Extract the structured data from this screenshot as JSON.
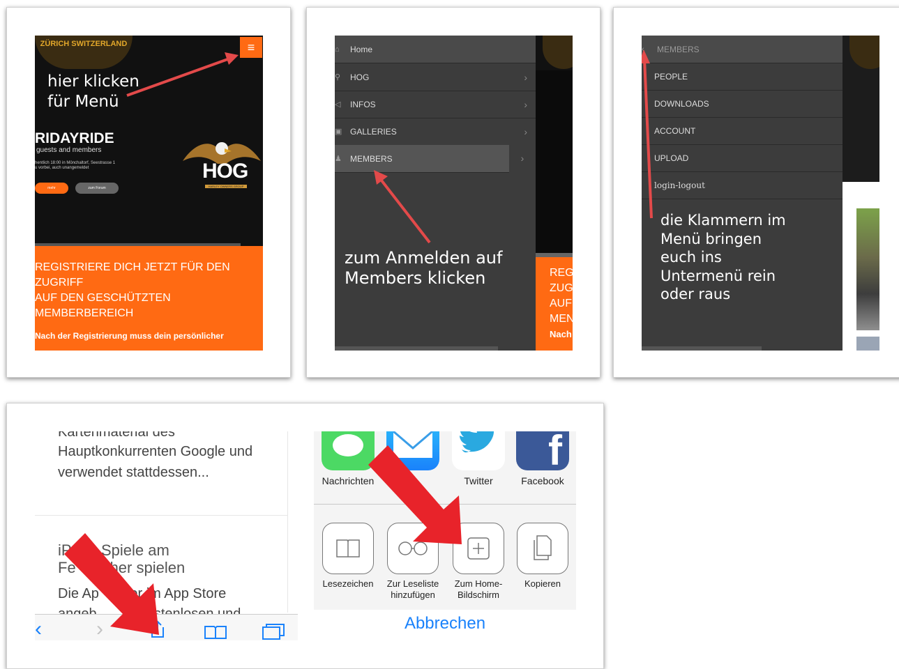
{
  "panel1": {
    "logo_text": "ZÜRICH SWITZERLAND",
    "annotation_line1": "hier klicken",
    "annotation_line2": "für Menü",
    "hero_title": "RIDAYRIDE",
    "hero_sub": "guests and members",
    "hero_detail1": "hentlich 18:00 in Mönchaltorf, Seestrasse 1",
    "hero_detail2": "u vorbei, auch unangemeldet",
    "btn_orange": "mehr",
    "btn_grey": "zum Forum",
    "hog_logo": "HOG",
    "hog_sub": "HARLEY OWNERS GROUP",
    "register_line1": "REGISTRIERE DICH JETZT FÜR DEN",
    "register_line2": "ZUGRIFF",
    "register_line3": "AUF DEN GESCHÜTZTEN",
    "register_line4": "MEMBERBEREICH",
    "register_bold": "Nach der Registrierung muss dein persönlicher"
  },
  "panel2": {
    "menu": [
      {
        "label": "Home",
        "icon": "home-icon"
      },
      {
        "label": "HOG",
        "icon": "motorcycle-icon"
      },
      {
        "label": "INFOS",
        "icon": "bullhorn-icon"
      },
      {
        "label": "GALLERIES",
        "icon": "image-icon"
      },
      {
        "label": "MEMBERS",
        "icon": "user-plus-icon"
      }
    ],
    "annotation_line1": "zum Anmelden auf",
    "annotation_line2": "Members klicken",
    "side_text": [
      "REG",
      "ZUG",
      "AUF",
      "MEN",
      "Nach"
    ]
  },
  "panel3": {
    "header": "MEMBERS",
    "menu": [
      "PEOPLE",
      "DOWNLOADS",
      "ACCOUNT",
      "UPLOAD",
      "login-logout"
    ],
    "annotation_lines": [
      "die Klammern im",
      "Menü bringen",
      "euch ins",
      "Untermenü rein",
      "oder raus"
    ]
  },
  "panel4": {
    "article_cut": "Kartenmaterial des",
    "article_line1": "Hauptkonkurrenten Google und",
    "article_line2": "verwendet stattdessen...",
    "article2_title1": "iP  ne Spiele am",
    "article2_title2": "Fe        her spielen",
    "article2_body": "Die Ap        er im App Store",
    "article2_cut": "angeb           kostenlosen und",
    "share_apps": [
      "Nachrichten",
      "Twitter",
      "Facebook"
    ],
    "actions": [
      {
        "label1": "Lesezeichen",
        "label2": "",
        "icon": "book-icon"
      },
      {
        "label1": "Zur Leseliste",
        "label2": "hinzufügen",
        "icon": "glasses-icon"
      },
      {
        "label1": "Zum Home-",
        "label2": "Bildschirm",
        "icon": "plus-square-icon"
      },
      {
        "label1": "Kopieren",
        "label2": "",
        "icon": "copy-icon"
      }
    ],
    "cancel": "Abbrechen"
  },
  "colors": {
    "orange": "#ff6a13",
    "dark_menu": "#3b3b3b",
    "ios_blue": "#1a82fb",
    "arrow_red": "#e8232a",
    "annotation_arrow": "#e34a4a"
  }
}
